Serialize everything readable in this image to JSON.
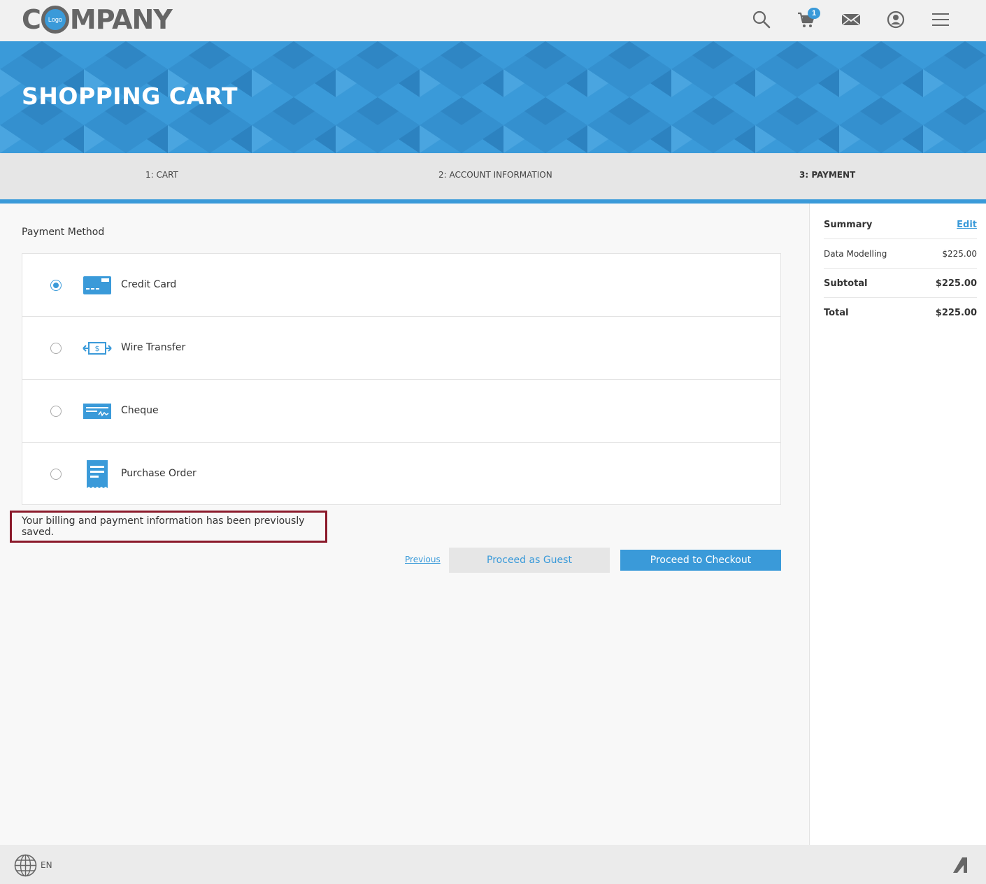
{
  "header": {
    "logo_left": "C",
    "logo_inner": "Logo",
    "logo_right": "MPANY",
    "cart_count": "1",
    "icons": [
      "search-icon",
      "cart-icon",
      "mail-icon",
      "user-icon",
      "menu-icon"
    ]
  },
  "banner": {
    "title": "SHOPPING CART"
  },
  "steps": [
    {
      "label": "1: CART",
      "active": false
    },
    {
      "label": "2: ACCOUNT INFORMATION",
      "active": false
    },
    {
      "label": "3: PAYMENT",
      "active": true
    }
  ],
  "payment": {
    "title": "Payment Method",
    "methods": [
      {
        "label": "Credit Card",
        "icon": "credit-card-icon",
        "selected": true
      },
      {
        "label": "Wire Transfer",
        "icon": "wire-transfer-icon",
        "selected": false
      },
      {
        "label": "Cheque",
        "icon": "cheque-icon",
        "selected": false
      },
      {
        "label": "Purchase Order",
        "icon": "purchase-order-icon",
        "selected": false
      }
    ],
    "saved_message": "Your billing and payment information has been previously saved."
  },
  "actions": {
    "previous": "Previous",
    "guest": "Proceed as Guest",
    "checkout": "Proceed to Checkout"
  },
  "summary": {
    "title": "Summary",
    "edit": "Edit",
    "item_name": "Data Modelling",
    "item_price": "$225.00",
    "subtotal_label": "Subtotal",
    "subtotal_value": "$225.00",
    "total_label": "Total",
    "total_value": "$225.00"
  },
  "footer": {
    "lang": "EN"
  },
  "colors": {
    "accent": "#3a9ad9",
    "highlight_border": "#8b1a2b"
  }
}
